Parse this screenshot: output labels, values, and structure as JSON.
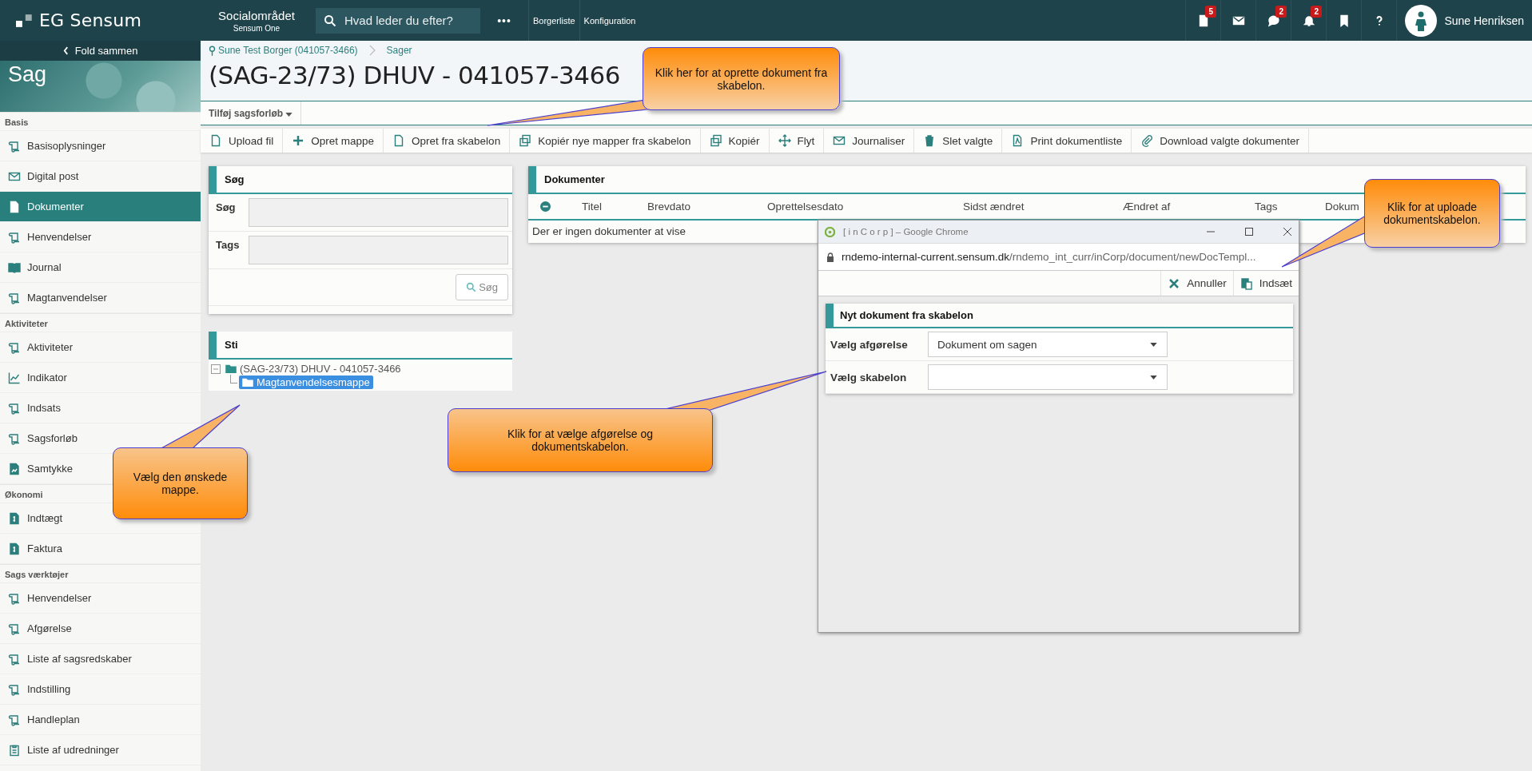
{
  "topbar": {
    "logo": "EG Sensum",
    "area": "Socialområdet",
    "area_sub": "Sensum One",
    "search": {
      "placeholder": "Hvad leder du efter?"
    },
    "more": "•••",
    "links": [
      "Borgerliste",
      "Konfiguration"
    ],
    "icons": [
      {
        "kind": "document",
        "badge": "5"
      },
      {
        "kind": "mail"
      },
      {
        "kind": "chat",
        "badge": "2"
      },
      {
        "kind": "bell",
        "badge": "2"
      },
      {
        "kind": "bookmark"
      },
      {
        "kind": "help"
      }
    ],
    "user": "Sune Henriksen"
  },
  "sidebar": {
    "collapse": "Fold sammen",
    "title": "Sag",
    "sections": [
      {
        "title": "Basis",
        "items": [
          {
            "label": "Basisoplysninger",
            "kind": "scroll",
            "selected": false
          },
          {
            "label": "Digital post",
            "kind": "envelope",
            "selected": false
          },
          {
            "label": "Dokumenter",
            "kind": "document",
            "selected": true
          },
          {
            "label": "Henvendelser",
            "kind": "scroll",
            "selected": false
          },
          {
            "label": "Journal",
            "kind": "book",
            "selected": false
          },
          {
            "label": "Magtanvendelser",
            "kind": "scroll",
            "selected": false
          }
        ]
      },
      {
        "title": "Aktiviteter",
        "items": [
          {
            "label": "Aktiviteter",
            "kind": "scroll",
            "selected": false
          },
          {
            "label": "Indikator",
            "kind": "chart",
            "selected": false
          },
          {
            "label": "Indsats",
            "kind": "scroll",
            "selected": false
          },
          {
            "label": "Sagsforløb",
            "kind": "scroll",
            "selected": false
          },
          {
            "label": "Samtykke",
            "kind": "image",
            "selected": false
          }
        ]
      },
      {
        "title": "Økonomi",
        "items": [
          {
            "label": "Indtægt",
            "kind": "invoice",
            "selected": false
          },
          {
            "label": "Faktura",
            "kind": "invoice",
            "selected": false
          }
        ]
      },
      {
        "title": "Sags værktøjer",
        "items": [
          {
            "label": "Henvendelser",
            "kind": "scroll",
            "selected": false
          },
          {
            "label": "Afgørelse",
            "kind": "scroll",
            "selected": false
          },
          {
            "label": "Liste af sagsredskaber",
            "kind": "scroll",
            "selected": false
          },
          {
            "label": "Indstilling",
            "kind": "scroll",
            "selected": false
          },
          {
            "label": "Handleplan",
            "kind": "scroll",
            "selected": false
          },
          {
            "label": "Liste af udredninger",
            "kind": "clipboard",
            "selected": false
          }
        ]
      }
    ]
  },
  "breadcrumb": [
    "Sune Test Borger (041057-3466)",
    "Sager"
  ],
  "title": "(SAG-23/73) DHUV - 041057-3466",
  "subnav": "Tilføj sagsforløb",
  "toolbar": [
    {
      "label": "Upload fil",
      "kind": "file"
    },
    {
      "label": "Opret mappe",
      "kind": "plus"
    },
    {
      "label": "Opret fra skabelon",
      "kind": "file"
    },
    {
      "label": "Kopiér nye mapper fra skabelon",
      "kind": "copy"
    },
    {
      "label": "Kopiér",
      "kind": "copy"
    },
    {
      "label": "Flyt",
      "kind": "move"
    },
    {
      "label": "Journaliser",
      "kind": "envelope"
    },
    {
      "label": "Slet valgte",
      "kind": "trash"
    },
    {
      "label": "Print dokumentliste",
      "kind": "pdf"
    },
    {
      "label": "Download valgte dokumenter",
      "kind": "clip"
    }
  ],
  "search_panel": {
    "title": "Søg",
    "fields": [
      {
        "label": "Søg"
      },
      {
        "label": "Tags"
      }
    ],
    "button": "Søg"
  },
  "path_panel": {
    "title": "Sti",
    "tree": [
      {
        "label": "(SAG-23/73) DHUV - 041057-3466",
        "expanded": true,
        "selected": false,
        "children": [
          {
            "label": "Magtanvendelsesmappe",
            "selected": true
          }
        ]
      }
    ]
  },
  "documents": {
    "title": "Dokumenter",
    "columns": [
      "Titel",
      "Brevdato",
      "Oprettelsesdato",
      "Sidst ændret",
      "Ændret af",
      "Tags",
      "Dokum"
    ],
    "empty": "Der er ingen dokumenter at vise"
  },
  "popup": {
    "title": "[ i n C o r p ] – Google Chrome",
    "url_host": "rndemo-internal-current.sensum.dk",
    "url_path": "/rndemo_int_curr/inCorp/document/newDocTempl...",
    "actions": [
      {
        "label": "Annuller",
        "kind": "cancel"
      },
      {
        "label": "Indsæt",
        "kind": "paste"
      }
    ],
    "panel_title": "Nyt dokument fra skabelon",
    "fields": [
      {
        "label": "Vælg afgørelse",
        "value": "Dokument om sagen"
      },
      {
        "label": "Vælg skabelon"
      }
    ]
  },
  "callouts": [
    "Klik her for at oprette dokument fra skabelon.",
    "Klik for at uploade dokumentskabelon.",
    "Klik for at vælge afgørelse og dokumentskabelon.",
    "Vælg den ønskede mappe."
  ]
}
